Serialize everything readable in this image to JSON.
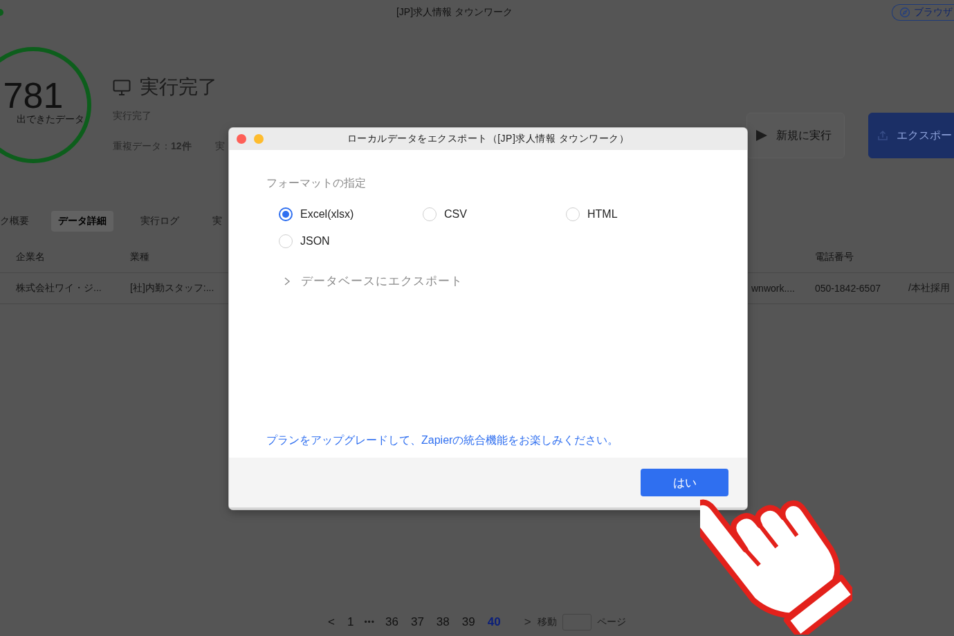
{
  "app": {
    "title": "[JP]求人情報 タウンワーク",
    "browser_button": "ブラウザ"
  },
  "summary": {
    "count": "781",
    "count_label": "出できたデータ",
    "status_title": "実行完了",
    "status_text": "実行完了",
    "duplicates_label": "重複データ：",
    "duplicates_value": "12件",
    "cut_text": "実"
  },
  "actions": [
    {
      "kind": "run",
      "label": "新規に実行"
    },
    {
      "kind": "export",
      "label": "エクスポー"
    }
  ],
  "tabs": [
    {
      "label": "ク概要",
      "selected": false
    },
    {
      "label": "データ詳細",
      "selected": true
    },
    {
      "label": "実行ログ",
      "selected": false
    },
    {
      "label": "実",
      "selected": false
    }
  ],
  "table": {
    "columns": [
      {
        "header": "企業名",
        "cell": "株式会社ワイ・ジ..."
      },
      {
        "header": "業種",
        "cell": "[社]内勤スタッフ:..."
      },
      {
        "cell": "wnwork...."
      },
      {
        "header": "電話番号",
        "cell": "050-1842-6507"
      },
      {
        "cell": "/本社採用"
      }
    ]
  },
  "pagination": {
    "prev": "<",
    "first_page": {
      "label": "1",
      "selected": false
    },
    "ellipsis": "•••",
    "pages": [
      {
        "label": "36",
        "selected": false
      },
      {
        "label": "37",
        "selected": false
      },
      {
        "label": "38",
        "selected": false
      },
      {
        "label": "39",
        "selected": false
      },
      {
        "label": "40",
        "selected": true
      }
    ],
    "next": ">",
    "goto_label": "移動",
    "goto_suffix": "ページ"
  },
  "dialog": {
    "title": "ローカルデータをエクスポート（[JP]求人情報 タウンワーク）",
    "format_label": "フォーマットの指定",
    "options": [
      {
        "label": "Excel(xlsx)",
        "selected": true
      },
      {
        "label": "CSV",
        "selected": false
      },
      {
        "label": "HTML",
        "selected": false
      },
      {
        "label": "JSON",
        "selected": false
      }
    ],
    "database_export": {
      "label": "データベースにエクスポート",
      "expanded": false
    },
    "upgrade_link": "プランをアップグレードして、Zapierの統合機能をお楽しみください。",
    "ok_button": "はい"
  }
}
